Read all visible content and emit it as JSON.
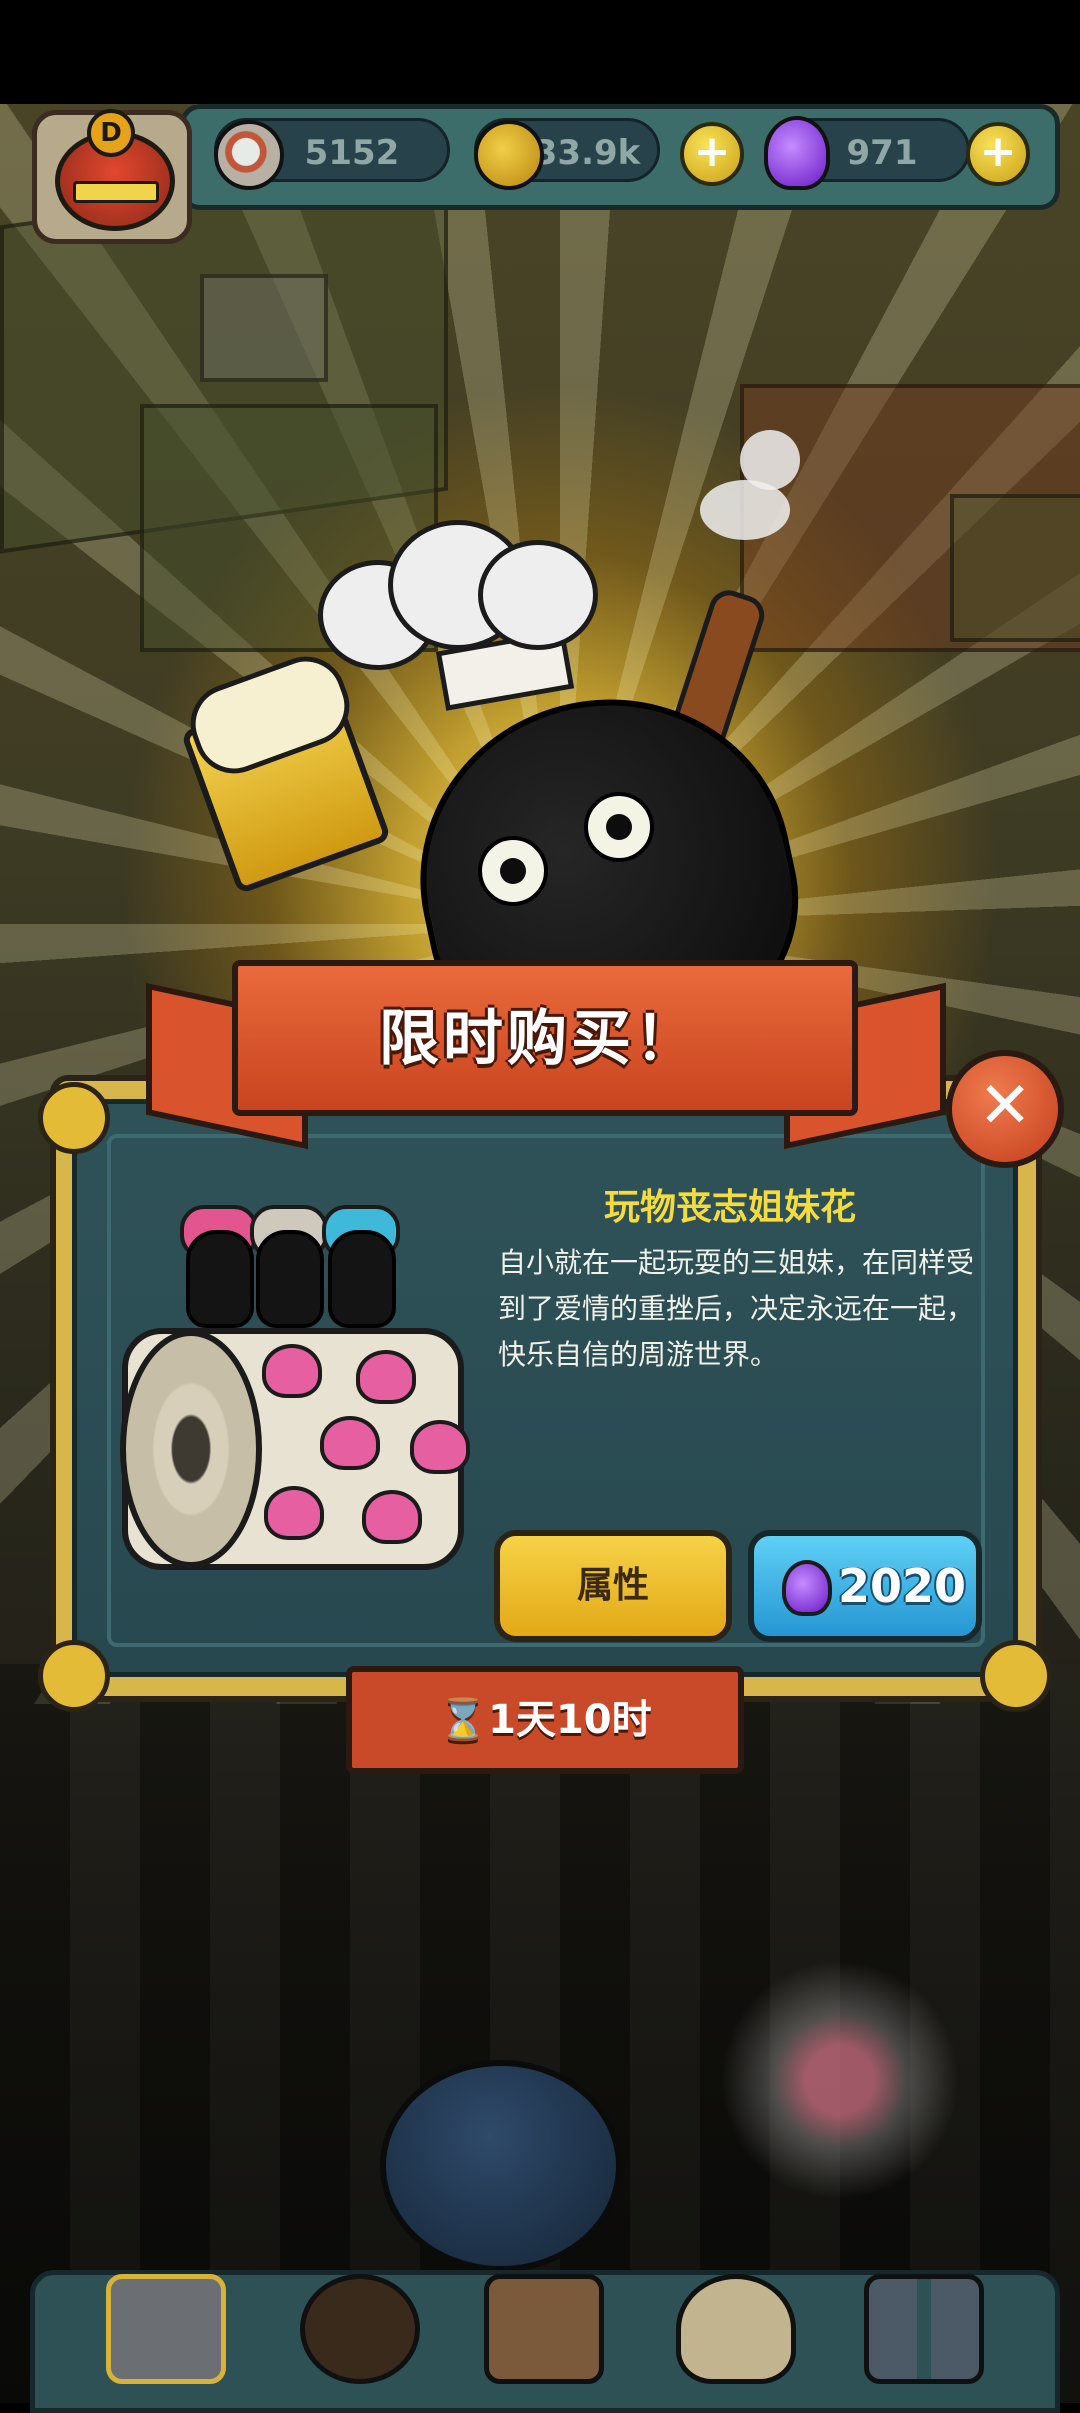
{
  "hud": {
    "eyeballs": "5152",
    "coins": "33.9k",
    "potions": "971",
    "avatar_badge": "D",
    "plus_label": "+"
  },
  "promo": {
    "banner_title": "限时购买！",
    "item_name": "玩物丧志姐妹花",
    "description": "自小就在一起玩耍的三姐妹，在同样受到了爱情的重挫后，决定永远在一起，快乐自信的周游世界。",
    "attributes_button": "属性",
    "price": "2020",
    "timer": "⌛1天10时",
    "close_label": "✕"
  },
  "colors": {
    "banner": "#d9532c",
    "panel": "#2f5258",
    "gold": "#e3bb36",
    "buy_button": "#2596d3",
    "attr_button": "#f6d247",
    "item_title": "#f3dc3b"
  },
  "icons": [
    "eyeball-icon",
    "coin-icon",
    "potion-icon",
    "plus-icon",
    "close-icon",
    "hourglass-icon"
  ]
}
